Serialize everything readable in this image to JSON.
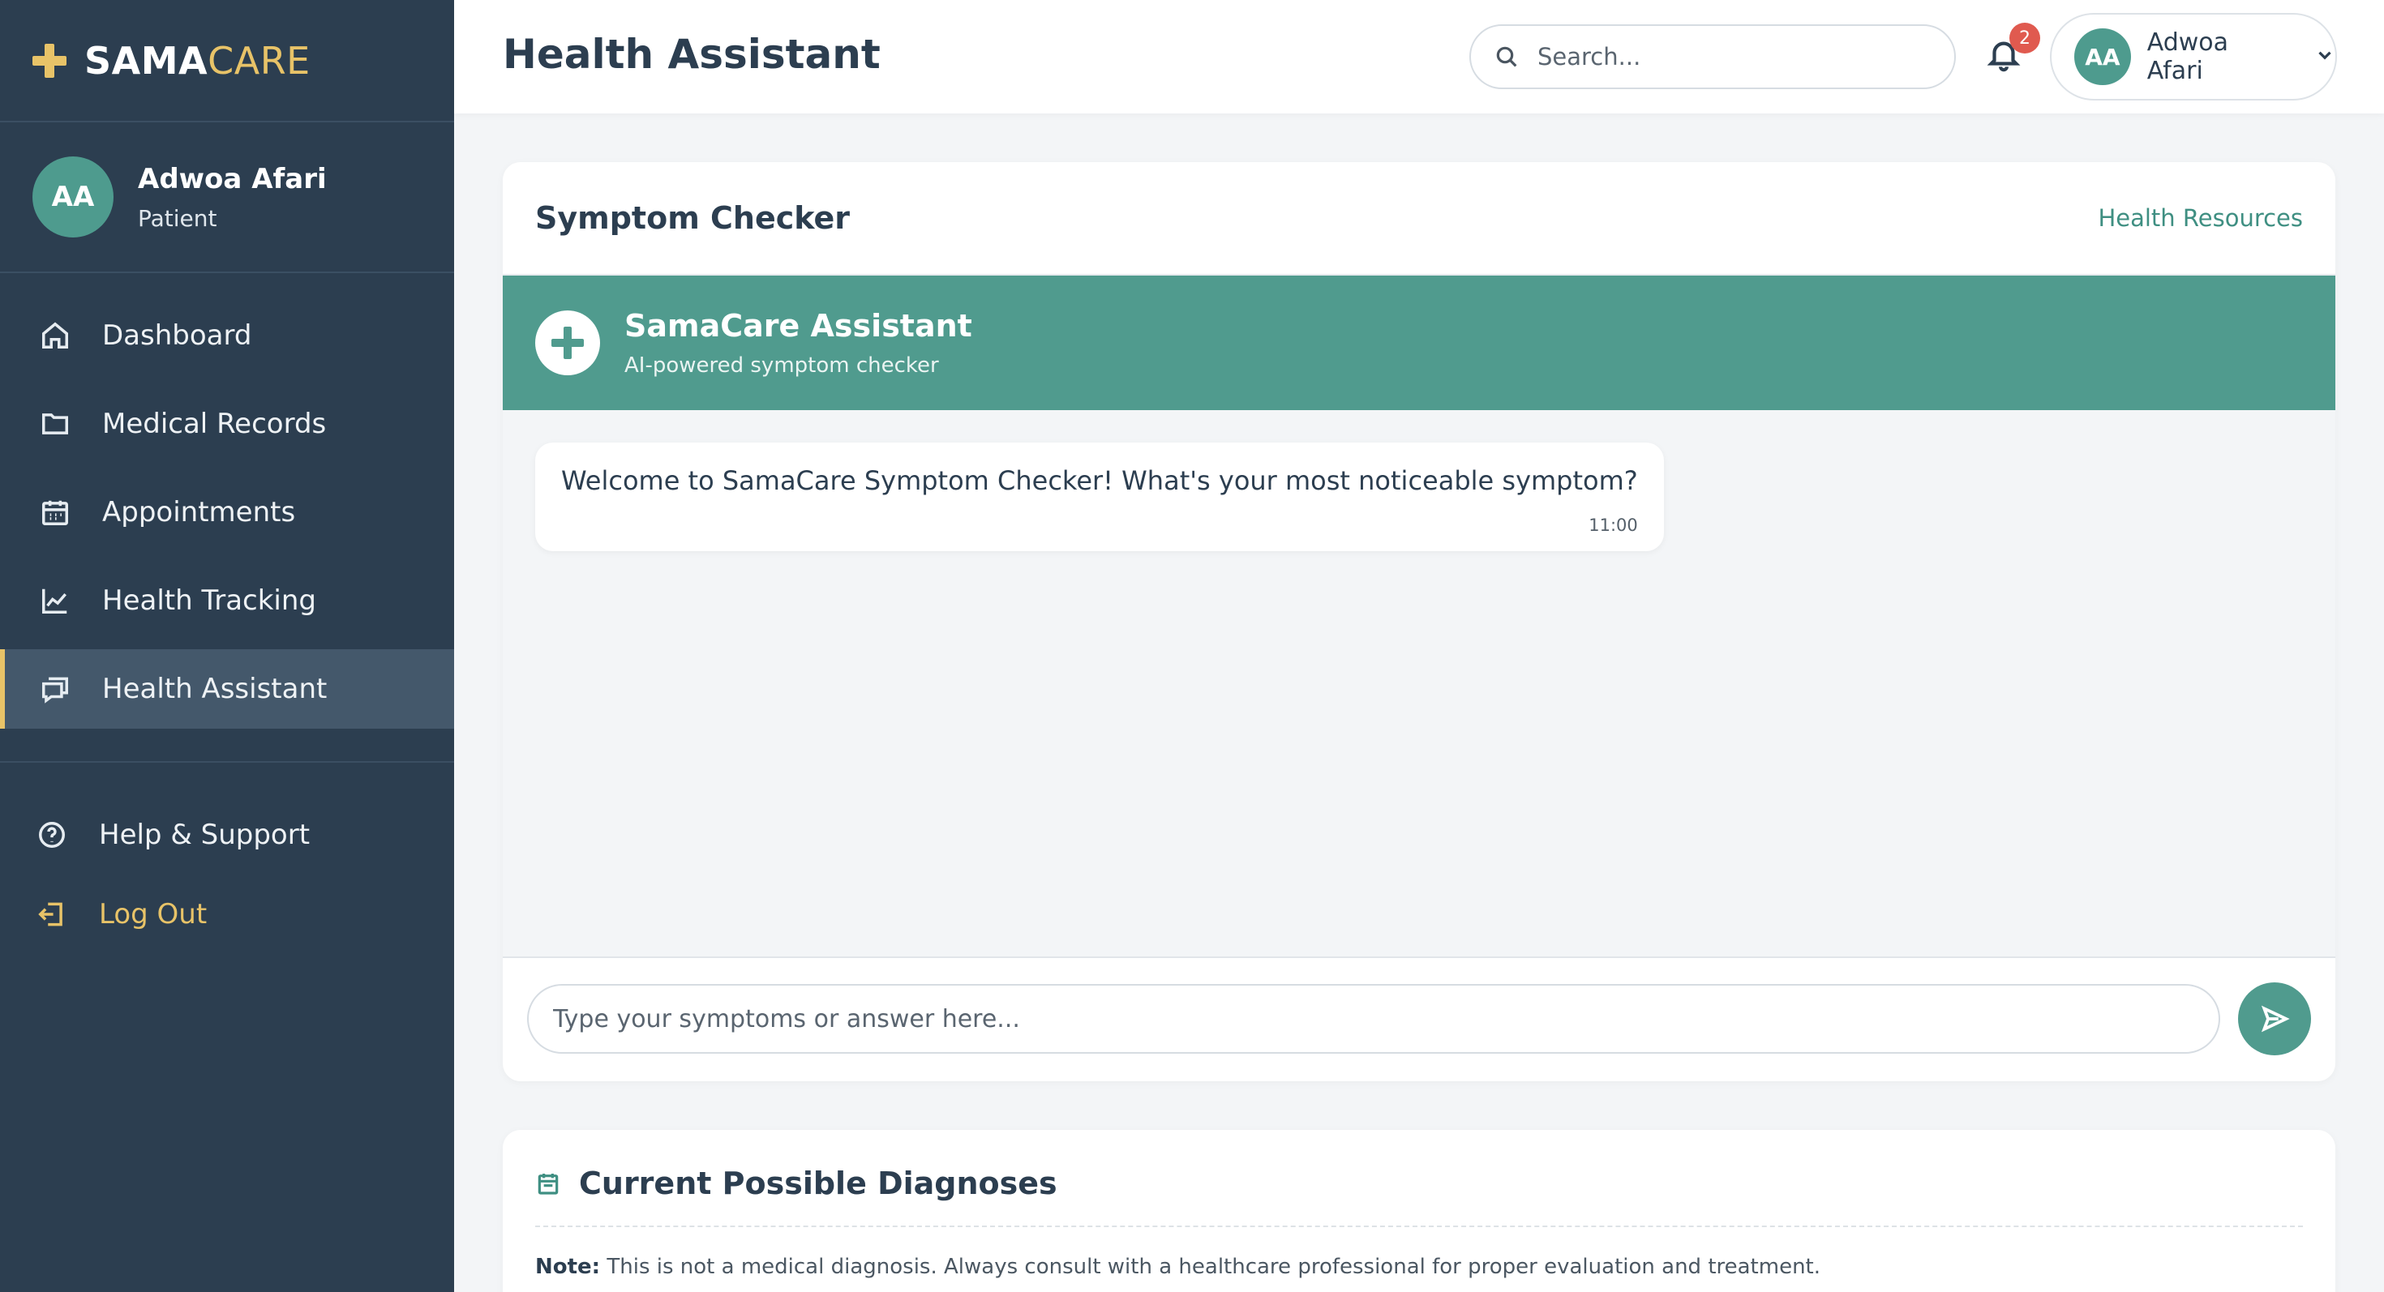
{
  "brand": {
    "part1": "SAMA",
    "part2": "CARE"
  },
  "user": {
    "initials": "AA",
    "name": "Adwoa Afari",
    "role": "Patient"
  },
  "nav": {
    "items": [
      {
        "label": "Dashboard",
        "icon": "home-icon"
      },
      {
        "label": "Medical Records",
        "icon": "folder-icon"
      },
      {
        "label": "Appointments",
        "icon": "calendar-icon"
      },
      {
        "label": "Health Tracking",
        "icon": "chart-line-icon"
      },
      {
        "label": "Health Assistant",
        "icon": "chat-icon",
        "active": true
      }
    ],
    "help": "Help & Support",
    "logout": "Log Out"
  },
  "header": {
    "title": "Health Assistant",
    "search_placeholder": "Search...",
    "notification_count": "2",
    "user_initials": "AA",
    "user_name": "Adwoa Afari"
  },
  "chat": {
    "title": "Symptom Checker",
    "resources_link": "Health Resources",
    "assistant_name": "SamaCare Assistant",
    "assistant_subtitle": "AI-powered symptom checker",
    "messages": [
      {
        "text": "Welcome to SamaCare Symptom Checker! What's your most noticeable symptom?",
        "time": "11:00"
      }
    ],
    "input_placeholder": "Type your symptoms or answer here..."
  },
  "diagnoses": {
    "title": "Current Possible Diagnoses",
    "note_label": "Note:",
    "note_text": " This is not a medical diagnosis. Always consult with a healthcare professional for proper evaluation and treatment."
  },
  "colors": {
    "sidebar": "#2c3e50",
    "accent": "#e8c368",
    "teal": "#509b8e",
    "badge": "#e05a4f"
  }
}
